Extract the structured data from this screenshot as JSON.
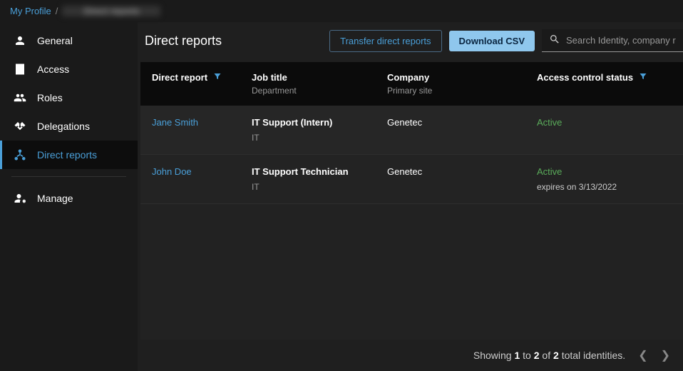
{
  "breadcrumb": {
    "root": "My Profile",
    "sep": "/",
    "current": "Direct reports"
  },
  "sidebar": {
    "items": [
      {
        "label": "General",
        "icon": "person-icon"
      },
      {
        "label": "Access",
        "icon": "building-icon"
      },
      {
        "label": "Roles",
        "icon": "group-icon"
      },
      {
        "label": "Delegations",
        "icon": "handshake-icon"
      },
      {
        "label": "Direct reports",
        "icon": "hierarchy-icon",
        "active": true
      },
      {
        "label": "Manage",
        "icon": "person-gear-icon"
      }
    ]
  },
  "header": {
    "title": "Direct reports",
    "transfer_label": "Transfer direct reports",
    "download_label": "Download CSV",
    "search_placeholder": "Search Identity, company r"
  },
  "table": {
    "columns": [
      {
        "main": "Direct report",
        "filter": true
      },
      {
        "main": "Job title",
        "sub": "Department"
      },
      {
        "main": "Company",
        "sub": "Primary site"
      },
      {
        "main": "Access control status",
        "filter": true
      }
    ],
    "rows": [
      {
        "name": "Jane Smith",
        "job_title": "IT Support (Intern)",
        "department": "IT",
        "company": "Genetec",
        "status": "Active"
      },
      {
        "name": "John Doe",
        "job_title": "IT Support Technician",
        "department": "IT",
        "company": "Genetec",
        "status": "Active",
        "expires": "expires on 3/13/2022"
      }
    ]
  },
  "footer": {
    "showing_prefix": "Showing ",
    "from": "1",
    "to_word": " to ",
    "to": "2",
    "of_word": " of ",
    "total": "2",
    "suffix": " total identities."
  },
  "colors": {
    "accent": "#4a9fd8",
    "primary_button": "#8fc7ed",
    "status_active": "#5aab5a",
    "bg": "#1a1a1a"
  }
}
